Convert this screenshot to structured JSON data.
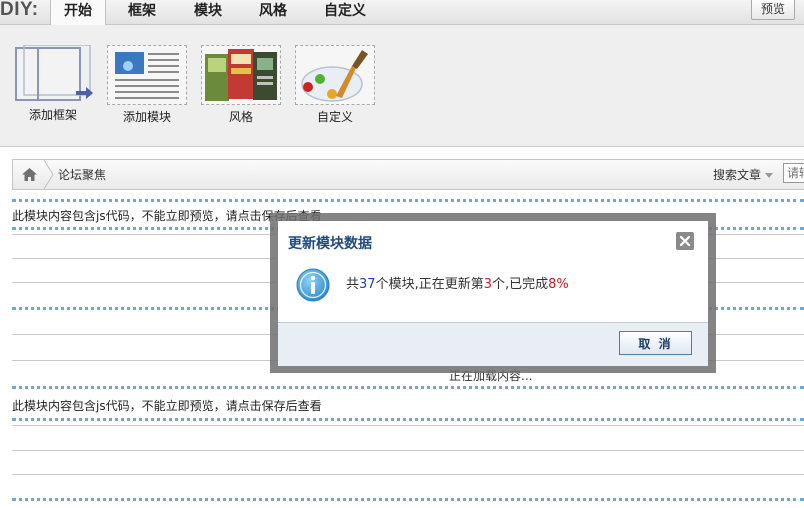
{
  "topbar": {
    "brand": "DIY:",
    "tabs": [
      {
        "label": "开始",
        "active": true
      },
      {
        "label": "框架",
        "active": false
      },
      {
        "label": "模块",
        "active": false
      },
      {
        "label": "风格",
        "active": false
      },
      {
        "label": "自定义",
        "active": false
      }
    ],
    "preview_label": "预览"
  },
  "toolbar": {
    "items": [
      {
        "label": "添加框架",
        "icon": "frame-icon"
      },
      {
        "label": "添加模块",
        "icon": "module-icon"
      },
      {
        "label": "风格",
        "icon": "style-icon"
      },
      {
        "label": "自定义",
        "icon": "palette-icon"
      }
    ]
  },
  "breadcrumb": {
    "current": "论坛聚焦",
    "search_type": "搜索文章",
    "search_placeholder": "请输"
  },
  "content": {
    "notice": "此模块内容包含js代码，不能立即预览，请点击保存后查看",
    "loading": "正在加载内容..."
  },
  "dialog": {
    "title": "更新模块数据",
    "msg_prefix": "共",
    "total": "37",
    "msg_mid1": "个模块,正在更新第",
    "current": "3",
    "msg_mid2": "个,已完成",
    "percent": "8%",
    "cancel_label": "取 消"
  },
  "colors": {
    "accent_blue": "#1b40c8",
    "accent_red": "#d01c1c",
    "title_blue": "#214a80"
  }
}
